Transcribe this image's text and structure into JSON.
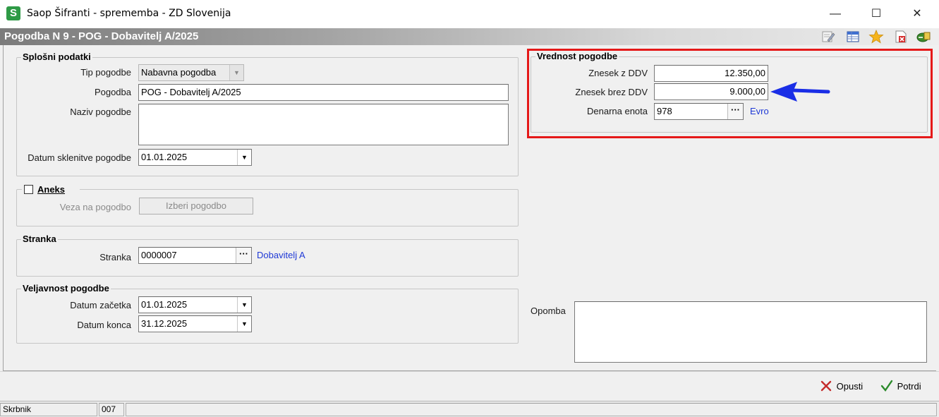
{
  "window": {
    "title": "Saop Šifranti - sprememba - ZD Slovenija",
    "icon_letter": "S",
    "minimize": "—",
    "maximize": "☐",
    "close": "✕"
  },
  "header": {
    "title": "Pogodba N 9 - POG - Dobavitelj A/2025"
  },
  "splosni": {
    "title": "Splošni podatki",
    "tip_label": "Tip pogodbe",
    "tip_value": "Nabavna pogodba",
    "pogodba_label": "Pogodba",
    "pogodba_value": "POG - Dobavitelj A/2025",
    "naziv_label": "Naziv pogodbe",
    "naziv_value": "",
    "datum_label": "Datum sklenitve pogodbe",
    "datum_value": "01.01.2025"
  },
  "aneks": {
    "title": "Aneks",
    "veza_label": "Veza na pogodbo",
    "izberi_button": "Izberi pogodbo",
    "checked": false
  },
  "stranka": {
    "title": "Stranka",
    "label": "Stranka",
    "value": "0000007",
    "name": "Dobavitelj A"
  },
  "veljavnost": {
    "title": "Veljavnost pogodbe",
    "zacetek_label": "Datum začetka",
    "zacetek_value": "01.01.2025",
    "konec_label": "Datum konca",
    "konec_value": "31.12.2025"
  },
  "vrednost": {
    "title": "Vrednost pogodbe",
    "z_ddv_label": "Znesek z DDV",
    "z_ddv_value": "12.350,00",
    "brez_ddv_label": "Znesek brez DDV",
    "brez_ddv_value": "9.000,00",
    "denarna_label": "Denarna enota",
    "denarna_value": "978",
    "denarna_name": "Evro"
  },
  "opomba": {
    "label": "Opomba",
    "value": ""
  },
  "footer": {
    "opusti": "Opusti",
    "potrdi": "Potrdi"
  },
  "status": {
    "cell1": "Skrbnik",
    "cell2": "007",
    "cell3": ""
  },
  "colors": {
    "highlight_frame": "#e51919",
    "arrow": "#1a2ee6",
    "link": "#1f39d6"
  }
}
